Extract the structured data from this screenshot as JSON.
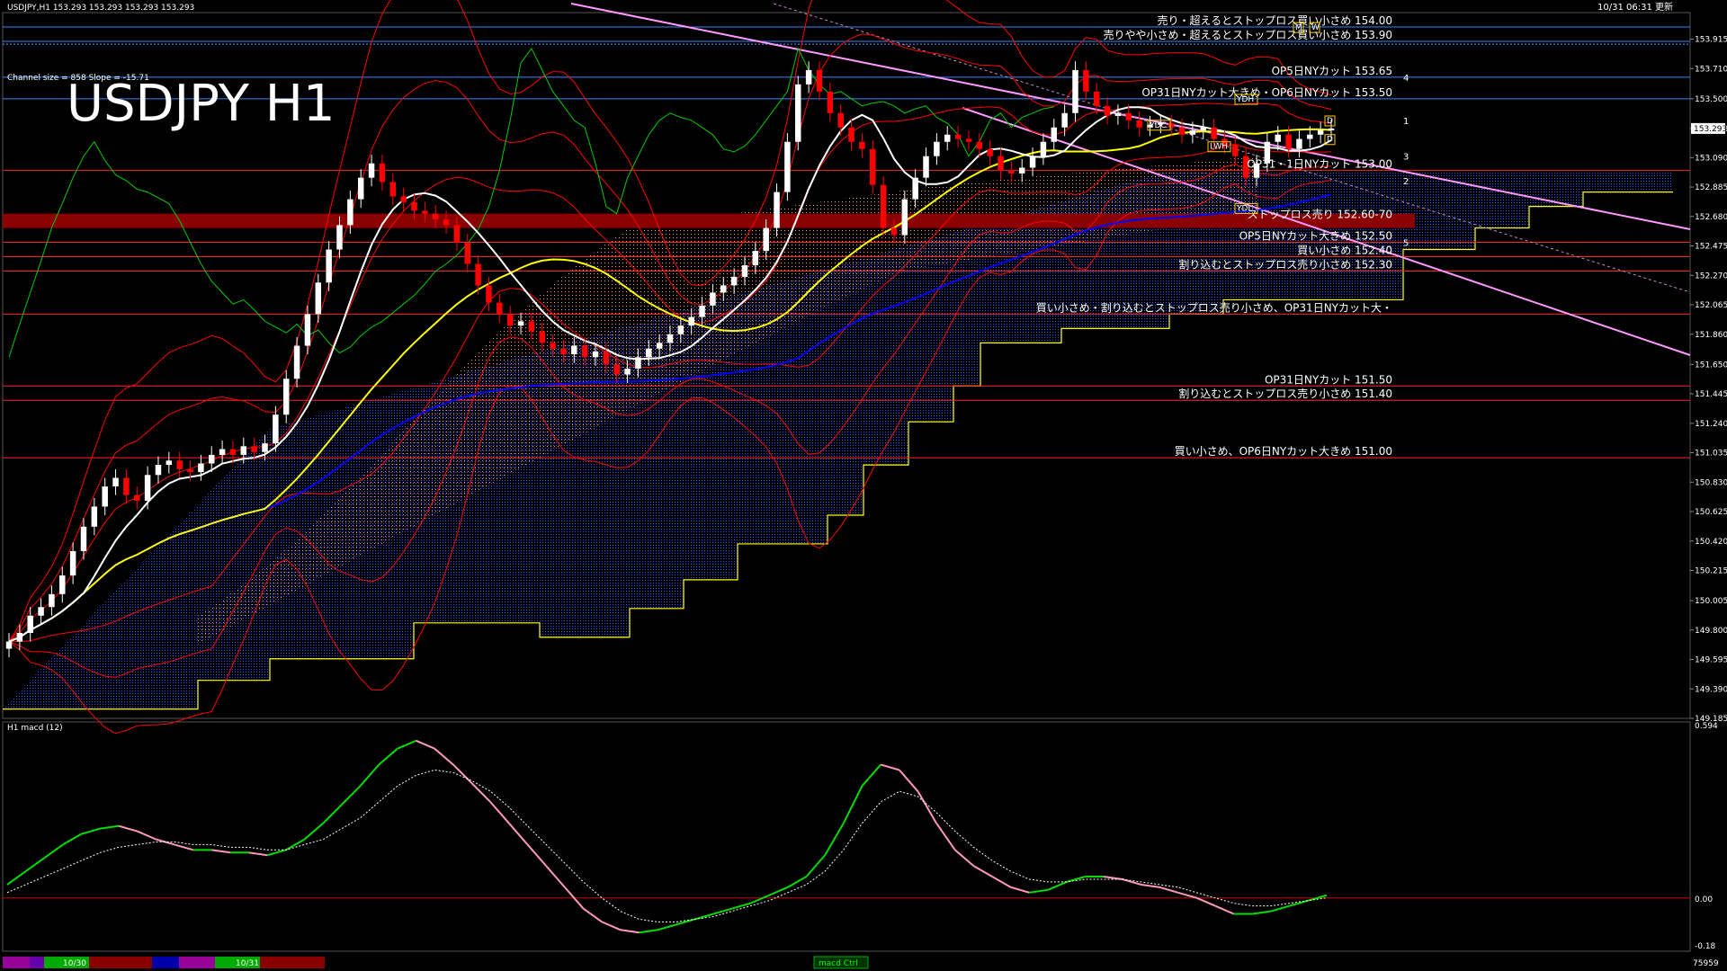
{
  "header": {
    "symbol_info": "USDJPY,H1  153.293 153.293 153.293 153.293",
    "datetime": "10/31 06:31 更新",
    "channel_info": "Channel size = 858 Slope = -15.71",
    "big_title": "USDJPY H1"
  },
  "macd": {
    "label": "H1  macd (12)",
    "max_label": "0.594",
    "zero_label": "0.00",
    "min_label": "-0.18",
    "footer_right": "75959"
  },
  "bottom_bar": {
    "date1": "10/30",
    "date2": "10/31",
    "center": "macd Ctrl"
  },
  "annotations": [
    {
      "text": "売り・超えるとストップロス買い小さめ 154.00",
      "price": 154.0
    },
    {
      "text": "売りやや小さめ・超えるとストップロス買い小さめ 153.90",
      "price": 153.9
    },
    {
      "text": "OP5日NYカット 153.65",
      "price": 153.65
    },
    {
      "text": "OP31日NYカット大きめ・OP6日NYカット 153.50",
      "price": 153.5
    },
    {
      "text": "OP31・1日NYカット 153.00",
      "price": 153.0
    },
    {
      "text": "ストップロス売り 152.60-70",
      "price": 152.65
    },
    {
      "text": "OP5日NYカット大きめ 152.50",
      "price": 152.5
    },
    {
      "text": "買い小さめ 152.40",
      "price": 152.4
    },
    {
      "text": "割り込むとストップロス売り小さめ 152.30",
      "price": 152.3
    },
    {
      "text": "買い小さめ・割り込むとストップロス売り小さめ、OP31日NYカット大・",
      "price": 152.0
    },
    {
      "text": "OP31日NYカット 151.50",
      "price": 151.5
    },
    {
      "text": "割り込むとストップロス売り小さめ 151.40",
      "price": 151.4
    },
    {
      "text": "買い小さめ、OP6日NYカット大きめ 151.00",
      "price": 151.0
    }
  ],
  "markers": [
    "YDH",
    "YDC",
    "LWH",
    "YDL",
    "D",
    "D",
    "M",
    "W"
  ],
  "channel_numbers": [
    "4",
    "1",
    "3",
    "2",
    "5"
  ],
  "colors": {
    "bull": "#ffffff",
    "bear": "#ff0000",
    "sma_white": "#ffffff",
    "sma_yellow": "#ffff00",
    "sma_blue": "#0000ff",
    "bollinger": "#ff0000",
    "chikou": "#00cc00",
    "kumo": "#ffff00",
    "channel": "#ff99ff",
    "macd_up": "#00dd00",
    "macd_down": "#ff99bb"
  },
  "chart_data": {
    "type": "line",
    "title": "USDJPY H1",
    "xlabel": "",
    "ylabel": "",
    "x_ticks": [
      "10/30",
      "10/31"
    ],
    "y_ticks": [
      153.915,
      153.71,
      153.5,
      153.293,
      153.09,
      152.885,
      152.68,
      152.475,
      152.27,
      152.065,
      151.86,
      151.65,
      151.445,
      151.24,
      151.035,
      150.83,
      150.625,
      150.42,
      150.215,
      150.005,
      149.8,
      149.595,
      149.39,
      149.185
    ],
    "ylim": [
      149.185,
      154.1
    ],
    "current_price": 153.293,
    "series": [
      {
        "name": "close",
        "values": [
          149.72,
          149.78,
          149.9,
          149.96,
          150.05,
          150.18,
          150.35,
          150.52,
          150.66,
          150.8,
          150.86,
          150.74,
          150.7,
          150.88,
          150.95,
          150.98,
          150.92,
          150.9,
          150.96,
          151.02,
          151.06,
          151.02,
          151.08,
          151.04,
          151.1,
          151.3,
          151.55,
          151.78,
          152.0,
          152.22,
          152.45,
          152.62,
          152.8,
          152.95,
          153.05,
          152.92,
          152.82,
          152.78,
          152.72,
          152.7,
          152.66,
          152.62,
          152.5,
          152.35,
          152.2,
          152.08,
          152.0,
          151.92,
          151.95,
          151.88,
          151.8,
          151.76,
          151.72,
          151.78,
          151.7,
          151.74,
          151.65,
          151.58,
          151.62,
          151.7,
          151.76,
          151.8,
          151.86,
          151.92,
          151.98,
          152.06,
          152.15,
          152.2,
          152.26,
          152.34,
          152.44,
          152.6,
          152.85,
          153.2,
          153.6,
          153.7,
          153.55,
          153.4,
          153.3,
          153.2,
          153.15,
          152.9,
          152.6,
          152.55,
          152.8,
          152.95,
          153.1,
          153.2,
          153.25,
          153.22,
          153.2,
          153.15,
          153.1,
          153.0,
          152.98,
          153.02,
          153.1,
          153.2,
          153.3,
          153.4,
          153.7,
          153.55,
          153.45,
          153.38,
          153.4,
          153.35,
          153.3,
          153.32,
          153.33,
          153.3,
          153.25,
          153.28,
          153.3,
          153.22,
          153.18,
          153.1,
          152.95,
          153.05,
          153.2,
          153.25,
          153.15,
          153.22,
          153.25,
          153.28,
          153.293
        ]
      },
      {
        "name": "macd",
        "values": [
          0.05,
          0.1,
          0.15,
          0.2,
          0.24,
          0.26,
          0.27,
          0.25,
          0.22,
          0.2,
          0.18,
          0.18,
          0.17,
          0.17,
          0.16,
          0.18,
          0.22,
          0.28,
          0.35,
          0.42,
          0.5,
          0.56,
          0.59,
          0.56,
          0.5,
          0.43,
          0.36,
          0.28,
          0.2,
          0.12,
          0.04,
          -0.04,
          -0.09,
          -0.12,
          -0.13,
          -0.12,
          -0.1,
          -0.08,
          -0.06,
          -0.04,
          -0.02,
          0.01,
          0.04,
          0.08,
          0.16,
          0.28,
          0.42,
          0.5,
          0.48,
          0.4,
          0.28,
          0.18,
          0.12,
          0.08,
          0.04,
          0.02,
          0.03,
          0.06,
          0.08,
          0.08,
          0.07,
          0.05,
          0.04,
          0.02,
          0.0,
          -0.03,
          -0.06,
          -0.06,
          -0.05,
          -0.03,
          -0.01,
          0.01
        ]
      },
      {
        "name": "signal",
        "values": [
          0.02,
          0.05,
          0.08,
          0.11,
          0.14,
          0.17,
          0.19,
          0.2,
          0.21,
          0.21,
          0.2,
          0.2,
          0.19,
          0.19,
          0.18,
          0.18,
          0.2,
          0.22,
          0.26,
          0.3,
          0.36,
          0.42,
          0.46,
          0.48,
          0.47,
          0.44,
          0.4,
          0.34,
          0.27,
          0.2,
          0.13,
          0.06,
          0.0,
          -0.05,
          -0.08,
          -0.09,
          -0.09,
          -0.08,
          -0.07,
          -0.05,
          -0.03,
          -0.01,
          0.02,
          0.05,
          0.1,
          0.18,
          0.28,
          0.36,
          0.4,
          0.38,
          0.32,
          0.25,
          0.19,
          0.14,
          0.1,
          0.07,
          0.06,
          0.06,
          0.07,
          0.07,
          0.07,
          0.06,
          0.05,
          0.04,
          0.02,
          0.0,
          -0.02,
          -0.03,
          -0.03,
          -0.02,
          -0.01,
          0.0
        ]
      }
    ]
  }
}
